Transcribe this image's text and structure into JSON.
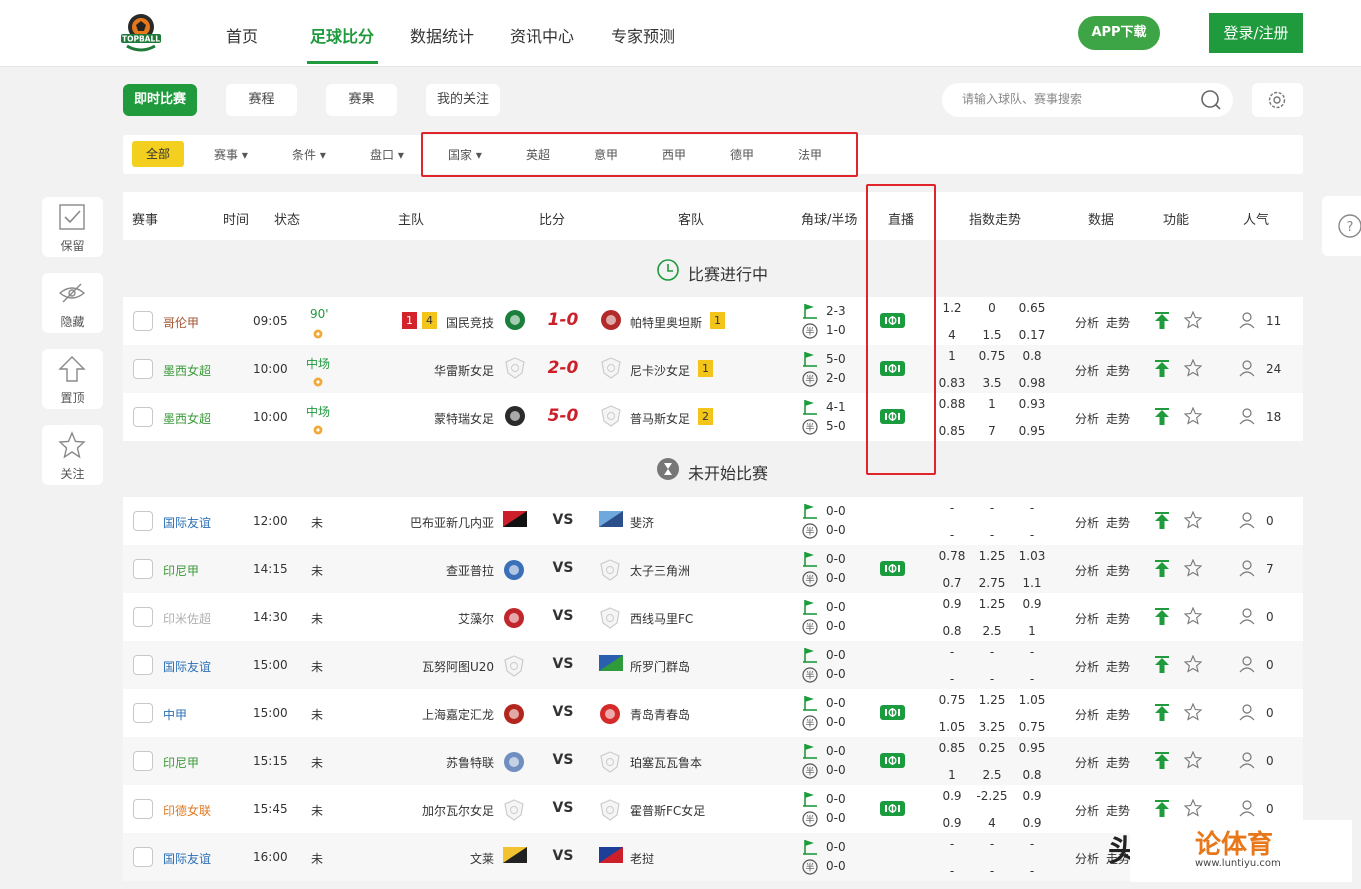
{
  "brand": {
    "logo_text": "TOPBALL",
    "accent": "#1f9a3d"
  },
  "nav": {
    "items": [
      "首页",
      "足球比分",
      "数据统计",
      "资讯中心",
      "专家预测"
    ],
    "active": "足球比分"
  },
  "header_buttons": {
    "app": "APP下载",
    "login": "登录/注册"
  },
  "tabs": [
    "即时比赛",
    "赛程",
    "赛果",
    "我的关注"
  ],
  "search": {
    "placeholder": "请输入球队、赛事搜索"
  },
  "filters": {
    "all": "全部",
    "items": [
      "赛事 ▾",
      "条件 ▾",
      "盘口 ▾",
      "国家 ▾",
      "英超",
      "意甲",
      "西甲",
      "德甲",
      "法甲"
    ]
  },
  "side": [
    "保留",
    "隐藏",
    "置顶",
    "关注"
  ],
  "columns": [
    "赛事",
    "时间",
    "状态",
    "主队",
    "比分",
    "客队",
    "角球/半场",
    "直播",
    "指数走势",
    "数据",
    "功能",
    "人气"
  ],
  "sections": {
    "live": "比赛进行中",
    "upcoming": "未开始比赛"
  },
  "actions": {
    "analysis": "分析",
    "trend": "走势"
  },
  "live_matches": [
    {
      "league": "哥伦甲",
      "league_color": "#a0522d",
      "time": "09:05",
      "status": "90'",
      "red": "1",
      "yellow_home": "4",
      "home": "国民竞技",
      "score": "1-0",
      "away": "帕特里奥坦斯",
      "yellow_away": "1",
      "corner": "2-3",
      "half": "1-0",
      "odds": [
        "1.2",
        "0",
        "0.65",
        "4",
        "1.5",
        "0.17"
      ],
      "popularity": "11"
    },
    {
      "league": "墨西女超",
      "league_color": "#3a9a3a",
      "time": "10:00",
      "status": "中场",
      "home": "华雷斯女足",
      "score": "2-0",
      "away": "尼卡沙女足",
      "yellow_away": "1",
      "corner": "5-0",
      "half": "2-0",
      "odds": [
        "1",
        "0.75",
        "0.8",
        "0.83",
        "3.5",
        "0.98"
      ],
      "popularity": "24"
    },
    {
      "league": "墨西女超",
      "league_color": "#3a9a3a",
      "time": "10:00",
      "status": "中场",
      "home": "蒙特瑞女足",
      "score": "5-0",
      "away": "普马斯女足",
      "yellow_away": "2",
      "corner": "4-1",
      "half": "5-0",
      "odds": [
        "0.88",
        "1",
        "0.93",
        "0.85",
        "7",
        "0.95"
      ],
      "popularity": "18"
    }
  ],
  "upcoming_matches": [
    {
      "league": "国际友谊",
      "league_color": "#2a6fb5",
      "time": "12:00",
      "status": "未",
      "home": "巴布亚新几内亚",
      "vs": "VS",
      "away": "斐济",
      "corner": "0-0",
      "half": "0-0",
      "live": false,
      "odds": [
        "-",
        "-",
        "-",
        "-",
        "-",
        "-"
      ],
      "popularity": "0"
    },
    {
      "league": "印尼甲",
      "league_color": "#3a9a3a",
      "time": "14:15",
      "status": "未",
      "home": "查亚普拉",
      "vs": "VS",
      "away": "太子三角洲",
      "corner": "0-0",
      "half": "0-0",
      "live": true,
      "odds": [
        "0.78",
        "1.25",
        "1.03",
        "0.7",
        "2.75",
        "1.1"
      ],
      "popularity": "7"
    },
    {
      "league": "印米佐超",
      "league_color": "#b0b0b0",
      "time": "14:30",
      "status": "未",
      "home": "艾藻尔",
      "vs": "VS",
      "away": "西线马里FC",
      "corner": "0-0",
      "half": "0-0",
      "live": false,
      "odds": [
        "0.9",
        "1.25",
        "0.9",
        "0.8",
        "2.5",
        "1"
      ],
      "popularity": "0"
    },
    {
      "league": "国际友谊",
      "league_color": "#2a6fb5",
      "time": "15:00",
      "status": "未",
      "home": "瓦努阿图U20",
      "vs": "VS",
      "away": "所罗门群岛",
      "corner": "0-0",
      "half": "0-0",
      "live": false,
      "odds": [
        "-",
        "-",
        "-",
        "-",
        "-",
        "-"
      ],
      "popularity": "0"
    },
    {
      "league": "中甲",
      "league_color": "#2a6fb5",
      "time": "15:00",
      "status": "未",
      "home": "上海嘉定汇龙",
      "vs": "VS",
      "away": "青岛青春岛",
      "corner": "0-0",
      "half": "0-0",
      "live": true,
      "odds": [
        "0.75",
        "1.25",
        "1.05",
        "1.05",
        "3.25",
        "0.75"
      ],
      "popularity": "0"
    },
    {
      "league": "印尼甲",
      "league_color": "#3a9a3a",
      "time": "15:15",
      "status": "未",
      "home": "苏鲁特联",
      "vs": "VS",
      "away": "珀塞瓦瓦鲁本",
      "corner": "0-0",
      "half": "0-0",
      "live": true,
      "odds": [
        "0.85",
        "0.25",
        "0.95",
        "1",
        "2.5",
        "0.8"
      ],
      "popularity": "0"
    },
    {
      "league": "印德女联",
      "league_color": "#e07b24",
      "time": "15:45",
      "status": "未",
      "home": "加尔瓦尔女足",
      "vs": "VS",
      "away": "霍普斯FC女足",
      "corner": "0-0",
      "half": "0-0",
      "live": true,
      "odds": [
        "0.9",
        "-2.25",
        "0.9",
        "0.9",
        "4",
        "0.9"
      ],
      "popularity": "0"
    },
    {
      "league": "国际友谊",
      "league_color": "#2a6fb5",
      "time": "16:00",
      "status": "未",
      "home": "文莱",
      "vs": "VS",
      "away": "老挝",
      "corner": "0-0",
      "half": "0-0",
      "live": false,
      "odds": [
        "-",
        "-",
        "-",
        "-",
        "-",
        "-"
      ],
      "popularity": ""
    }
  ],
  "watermark": {
    "mark": "头",
    "site": "论体育",
    "url": "www.luntiyu.com"
  }
}
